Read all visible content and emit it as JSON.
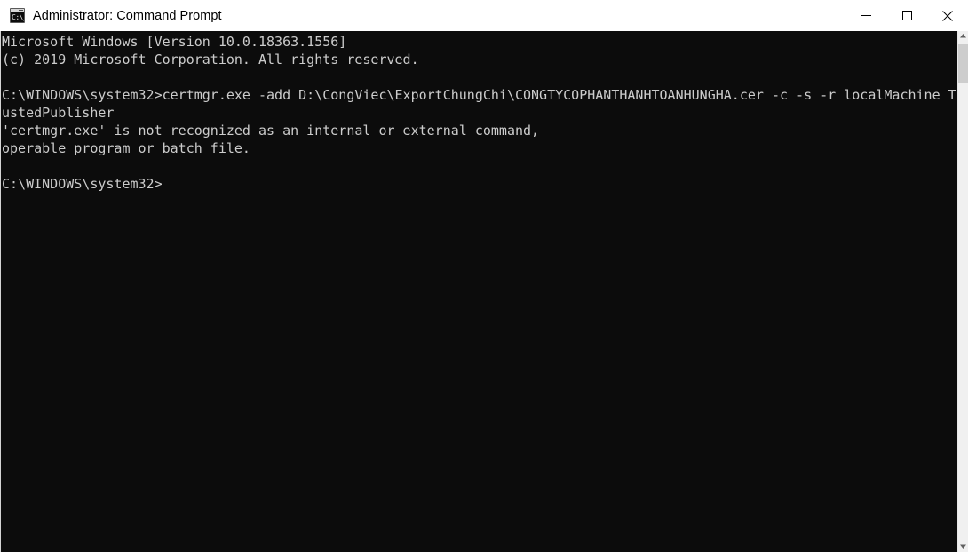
{
  "window": {
    "title": "Administrator: Command Prompt",
    "icon": "cmd-icon",
    "icon_glyph": "C:\\_",
    "background_color": "#0c0c0c",
    "text_color": "#cccccc",
    "titlebar_color": "#ffffff"
  },
  "window_controls": {
    "minimize": "minimize-icon",
    "maximize": "maximize-icon",
    "close": "close-icon"
  },
  "console": {
    "lines": [
      "Microsoft Windows [Version 10.0.18363.1556]",
      "(c) 2019 Microsoft Corporation. All rights reserved.",
      "",
      "C:\\WINDOWS\\system32>certmgr.exe -add D:\\CongViec\\ExportChungChi\\CONGTYCOPHANTHANHTOANHUNGHA.cer -c -s -r localMachine Tr",
      "ustedPublisher",
      "'certmgr.exe' is not recognized as an internal or external command,",
      "operable program or batch file.",
      "",
      "C:\\WINDOWS\\system32>"
    ],
    "full_text": "Microsoft Windows [Version 10.0.18363.1556]\n(c) 2019 Microsoft Corporation. All rights reserved.\n\nC:\\WINDOWS\\system32>certmgr.exe -add D:\\CongViec\\ExportChungChi\\CONGTYCOPHANTHANHTOANHUNGHA.cer -c -s -r localMachine Tr\nustedPublisher\n'certmgr.exe' is not recognized as an internal or external command,\noperable program or batch file.\n\nC:\\WINDOWS\\system32>",
    "prompt": "C:\\WINDOWS\\system32>",
    "command": "certmgr.exe -add D:\\CongViec\\ExportChungChi\\CONGTYCOPHANTHANHTOANHUNGHA.cer -c -s -r localMachine TrustedPublisher",
    "error_message": "'certmgr.exe' is not recognized as an internal or external command,\noperable program or batch file."
  },
  "scrollbar": {
    "up_arrow": "scroll-up-arrow-icon",
    "down_arrow": "scroll-down-arrow-icon",
    "thumb": "scrollbar-thumb",
    "track_color": "#f0f0f0",
    "thumb_color": "#cdcdcd"
  }
}
